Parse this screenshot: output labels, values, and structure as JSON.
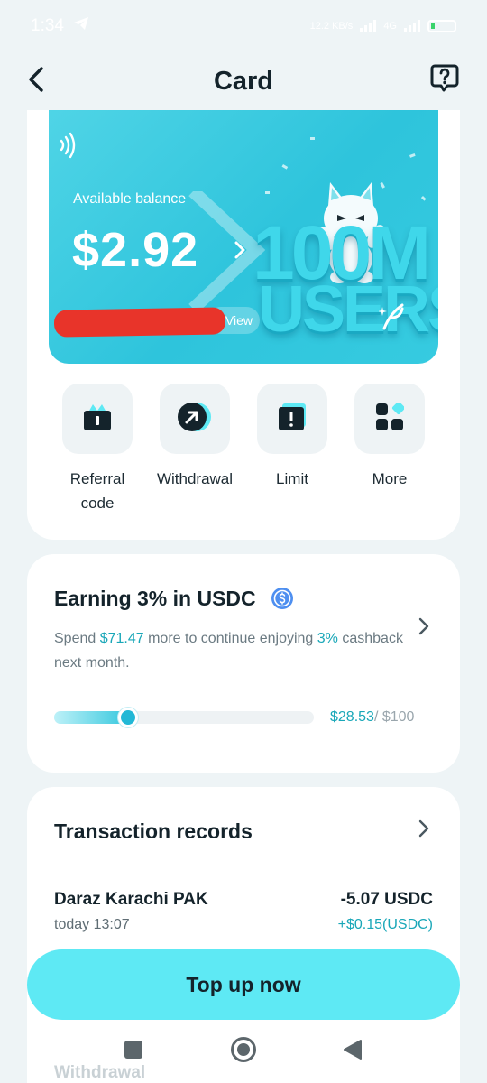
{
  "status_bar": {
    "time": "1:34",
    "network_speed": "12.2 KB/s",
    "network_type": "4G",
    "battery_level": 0.1
  },
  "header": {
    "title": "Card",
    "back_icon": "chevron-left-icon",
    "help_icon": "question-bubble-icon"
  },
  "card": {
    "balance_label": "Available balance",
    "balance_value": "$2.92",
    "view_label": "View",
    "promo_line1": "100M",
    "promo_line2": "USERS",
    "accent_color": "#2ec4dc"
  },
  "actions": [
    {
      "label": "Referral code",
      "icon": "gift-icon"
    },
    {
      "label": "Withdrawal",
      "icon": "arrow-up-right-icon"
    },
    {
      "label": "Limit",
      "icon": "alert-square-icon"
    },
    {
      "label": "More",
      "icon": "grid-icon"
    }
  ],
  "earning": {
    "title": "Earning 3% in USDC",
    "desc_prefix": "Spend ",
    "desc_amount": "$71.47",
    "desc_middle": " more to continue enjoying ",
    "desc_rate": "3%",
    "desc_suffix": " cashback next month.",
    "spent": "$28.53",
    "goal": "/ $100",
    "progress_fraction": 0.2853
  },
  "transactions": {
    "title": "Transaction records",
    "items": [
      {
        "merchant": "Daraz Karachi PAK",
        "time": "today 13:07",
        "amount": "-5.07 USDC",
        "cashback": "+$0.15(USDC)"
      }
    ],
    "next_item_label": "Withdrawal"
  },
  "topup_label": "Top up now",
  "nav": {
    "recents_icon": "square-icon",
    "home_icon": "circle-icon",
    "back_icon": "triangle-back-icon"
  }
}
